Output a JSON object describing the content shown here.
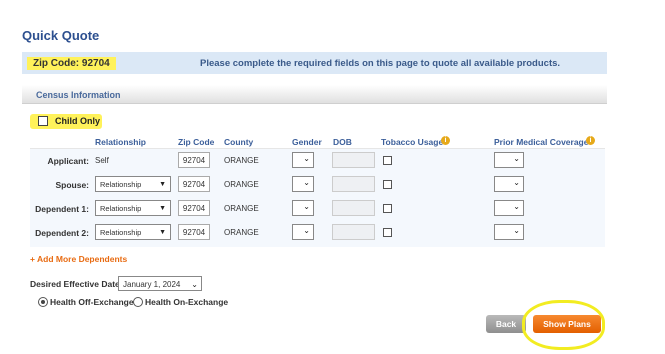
{
  "page": {
    "title": "Quick Quote"
  },
  "zip": {
    "label": "Zip Code: 92704",
    "message": "Please complete the required fields on this page to quote all available products."
  },
  "census": {
    "section_label": "Census Information",
    "child_only_label": "Child Only"
  },
  "table": {
    "headers": {
      "relationship": "Relationship",
      "zip": "Zip Code",
      "county": "County",
      "gender": "Gender",
      "dob": "DOB",
      "tobacco": "Tobacco Usage",
      "prior": "Prior Medical Coverage"
    },
    "info_icon_glyph": "i",
    "rows": [
      {
        "label": "Applicant:",
        "relationship": "Self",
        "zip": "92704",
        "county": "ORANGE"
      },
      {
        "label": "Spouse:",
        "relationship": "Relationship",
        "zip": "92704",
        "county": "ORANGE"
      },
      {
        "label": "Dependent 1:",
        "relationship": "Relationship",
        "zip": "92704",
        "county": "ORANGE"
      },
      {
        "label": "Dependent 2:",
        "relationship": "Relationship",
        "zip": "92704",
        "county": "ORANGE"
      }
    ]
  },
  "add_more_label": "+ Add More Dependents",
  "effective": {
    "label": "Desired Effective Date:",
    "value": "January 1, 2024"
  },
  "exchange": {
    "off_label": "Health Off-Exchange",
    "on_label": "Health On-Exchange",
    "selected": "off"
  },
  "buttons": {
    "back": "Back",
    "show_plans": "Show Plans"
  },
  "colors": {
    "accent_orange": "#e86b12",
    "title_blue": "#2c4f8f",
    "highlight_yellow": "#fff25a"
  }
}
